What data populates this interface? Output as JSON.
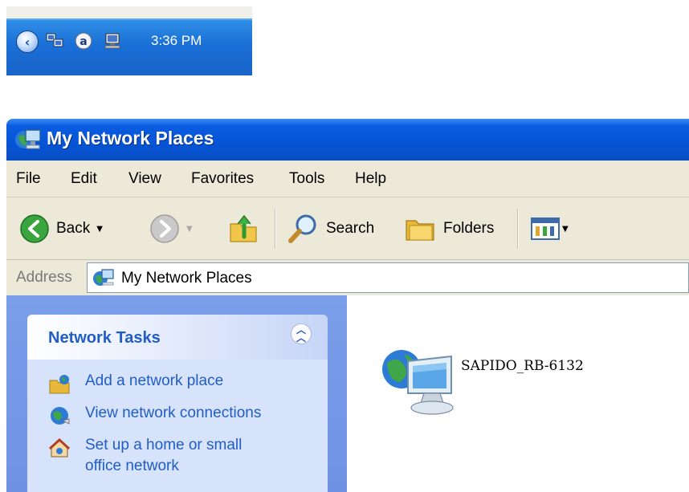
{
  "tray": {
    "clock": "3:36 PM",
    "icons": [
      "show-hidden-icons-chevron",
      "network-connection-icon",
      "app-a-icon",
      "monitor-network-icon"
    ]
  },
  "window": {
    "title": "My Network Places",
    "menu": [
      "File",
      "Edit",
      "View",
      "Favorites",
      "Tools",
      "Help"
    ],
    "toolbar": {
      "back_label": "Back",
      "search_label": "Search",
      "folders_label": "Folders"
    },
    "address": {
      "label": "Address",
      "value": "My Network Places"
    },
    "tasks": {
      "title": "Network Tasks",
      "items": [
        {
          "label": "Add a network place",
          "icon": "add-network-place-icon"
        },
        {
          "label": "View network connections",
          "icon": "network-connections-icon"
        },
        {
          "label": "Set up a home or small office network",
          "icon": "home-network-setup-icon"
        }
      ]
    },
    "content": {
      "items": [
        {
          "label": "SAPIDO_RB-6132",
          "icon": "network-computer-icon"
        }
      ]
    }
  },
  "colors": {
    "titlebar": "#0554d6",
    "taskpane": "#7b9eea",
    "task_link": "#215dc6",
    "chrome": "#ece9d8"
  }
}
